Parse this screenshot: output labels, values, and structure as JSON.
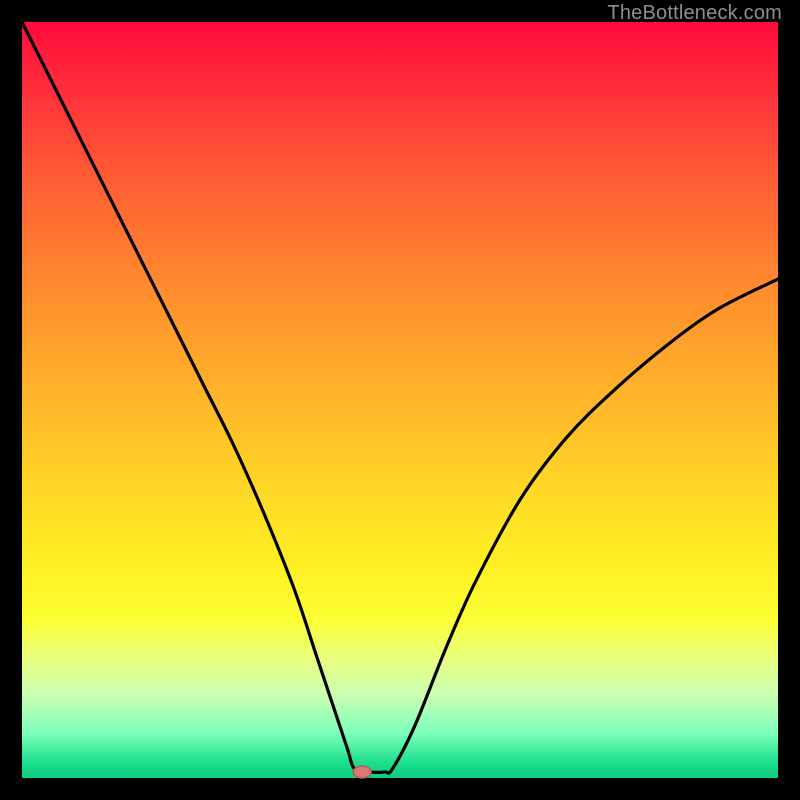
{
  "watermark": "TheBottleneck.com",
  "chart_data": {
    "type": "line",
    "title": "",
    "xlabel": "",
    "ylabel": "",
    "xlim": [
      0,
      100
    ],
    "ylim": [
      0,
      100
    ],
    "series": [
      {
        "name": "bottleneck-curve",
        "x": [
          0,
          4,
          8,
          12,
          16,
          20,
          24,
          28,
          32,
          36,
          39,
          41,
          43,
          44,
          46,
          48,
          49,
          52,
          56,
          60,
          66,
          72,
          78,
          85,
          92,
          100
        ],
        "y": [
          100,
          92,
          84,
          76,
          68,
          60,
          52,
          44,
          35,
          25,
          16,
          10,
          4,
          1.2,
          0.8,
          0.8,
          1.2,
          7,
          17,
          26,
          37,
          45,
          51,
          57,
          62,
          66
        ]
      }
    ],
    "marker": {
      "x": 45,
      "y": 0.8
    },
    "colors": {
      "curve": "#000000",
      "marker_fill": "#d77b76",
      "marker_stroke": "#b85a56"
    }
  }
}
